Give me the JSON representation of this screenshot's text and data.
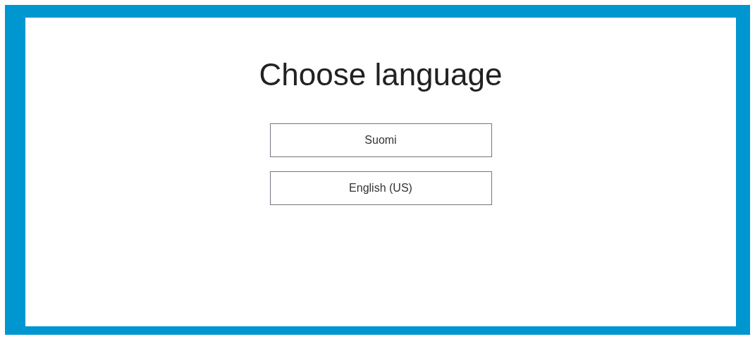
{
  "title": "Choose language",
  "languages": [
    {
      "label": "Suomi"
    },
    {
      "label": "English (US)"
    }
  ]
}
